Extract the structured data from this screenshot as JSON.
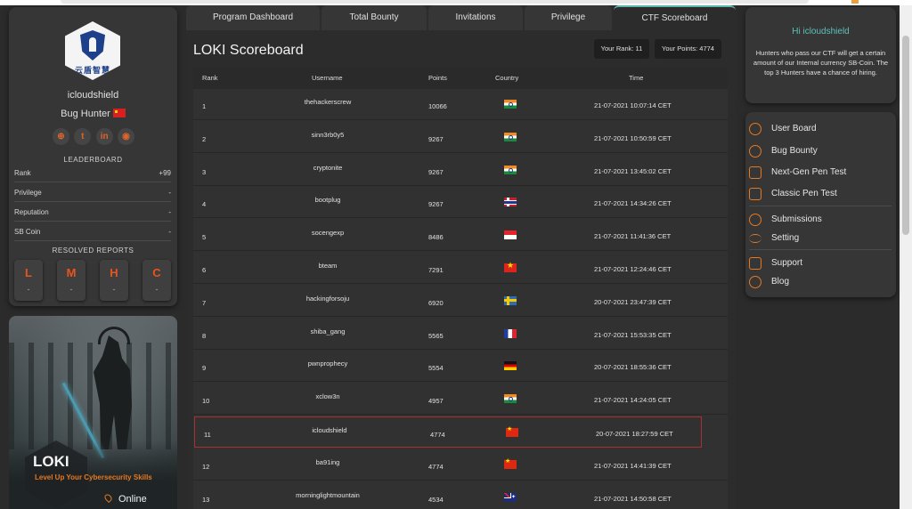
{
  "profile": {
    "logo_text": "云盾智慧",
    "username": "icloudshield",
    "role": "Bug Hunter",
    "social_icons": [
      "globe-icon",
      "twitter-icon",
      "linkedin-icon",
      "github-icon"
    ],
    "leaderboard_heading": "LEADERBOARD",
    "stats": [
      {
        "key": "Rank",
        "value": "+99"
      },
      {
        "key": "Privilege",
        "value": "-"
      },
      {
        "key": "Reputation",
        "value": "-"
      },
      {
        "key": "SB Coin",
        "value": "-"
      }
    ],
    "resolved_heading": "RESOLVED REPORTS",
    "severities": [
      {
        "letter": "L",
        "count": "-"
      },
      {
        "letter": "M",
        "count": "-"
      },
      {
        "letter": "H",
        "count": "-"
      },
      {
        "letter": "C",
        "count": "-"
      }
    ]
  },
  "banner": {
    "title": "LOKI",
    "tagline": "Level Up Your Cybersecurity Skills",
    "status": "Online"
  },
  "tabs": [
    {
      "label": "Program Dashboard"
    },
    {
      "label": "Total Bounty"
    },
    {
      "label": "Invitations"
    },
    {
      "label": "Privilege"
    },
    {
      "label": "CTF Scoreboard",
      "active": true
    }
  ],
  "scoreboard": {
    "title": "LOKI Scoreboard",
    "your_rank": "Your Rank: 11",
    "your_points": "Your Points: 4774",
    "columns": [
      "Rank",
      "Username",
      "Points",
      "Country",
      "Time"
    ],
    "rows": [
      {
        "rank": "1",
        "username": "thehackerscrew",
        "points": "10066",
        "country": "in",
        "time": "21-07-2021 10:07:14 CET"
      },
      {
        "rank": "2",
        "username": "sinn3rb0y5",
        "points": "9267",
        "country": "in",
        "time": "21-07-2021 10:50:59 CET"
      },
      {
        "rank": "3",
        "username": "cryptonite",
        "points": "9267",
        "country": "in",
        "time": "21-07-2021 13:45:02 CET"
      },
      {
        "rank": "4",
        "username": "bootplug",
        "points": "9267",
        "country": "no",
        "time": "21-07-2021 14:34:26 CET"
      },
      {
        "rank": "5",
        "username": "socengexp",
        "points": "8486",
        "country": "sg",
        "time": "21-07-2021 11:41:36 CET"
      },
      {
        "rank": "6",
        "username": "bteam",
        "points": "7291",
        "country": "vn",
        "time": "21-07-2021 12:24:46 CET"
      },
      {
        "rank": "7",
        "username": "hackingforsoju",
        "points": "6920",
        "country": "se",
        "time": "20-07-2021 23:47:39 CET"
      },
      {
        "rank": "8",
        "username": "shiba_gang",
        "points": "5565",
        "country": "fr",
        "time": "21-07-2021 15:53:35 CET"
      },
      {
        "rank": "9",
        "username": "pwnprophecy",
        "points": "5554",
        "country": "de",
        "time": "20-07-2021 18:55:36 CET"
      },
      {
        "rank": "10",
        "username": "xclow3n",
        "points": "4957",
        "country": "in",
        "time": "21-07-2021 14:24:05 CET"
      },
      {
        "rank": "11",
        "username": "icloudshield",
        "points": "4774",
        "country": "cn",
        "time": "20-07-2021 18:27:59 CET",
        "highlight": true
      },
      {
        "rank": "12",
        "username": "ba91ing",
        "points": "4774",
        "country": "cn",
        "time": "21-07-2021 14:41:39 CET"
      },
      {
        "rank": "13",
        "username": "morninglightmountain",
        "points": "4534",
        "country": "au",
        "time": "21-07-2021 14:50:58 CET"
      }
    ]
  },
  "welcome": {
    "greeting": "Hi icloudshield",
    "message": "Hunters who pass our CTF will get a certain amount of our Internal currency SB-Coin. The top 3 Hunters have a chance of hiring."
  },
  "menu": [
    {
      "label": "User Board",
      "icon": "user-board-icon"
    },
    {
      "label": "Bug Bounty",
      "icon": "bug-bounty-icon"
    },
    {
      "label": "Next-Gen Pen Test",
      "icon": "next-gen-pentest-icon"
    },
    {
      "label": "Classic Pen Test",
      "icon": "classic-pentest-icon"
    },
    {
      "label": "Submissions",
      "icon": "submissions-icon"
    },
    {
      "label": "Setting",
      "icon": "settings-icon"
    },
    {
      "label": "Support",
      "icon": "support-icon"
    },
    {
      "label": "Blog",
      "icon": "blog-icon"
    }
  ],
  "colors": {
    "accent": "#e8781e",
    "teal": "#5fc0b8",
    "highlight_border": "#a83030"
  }
}
